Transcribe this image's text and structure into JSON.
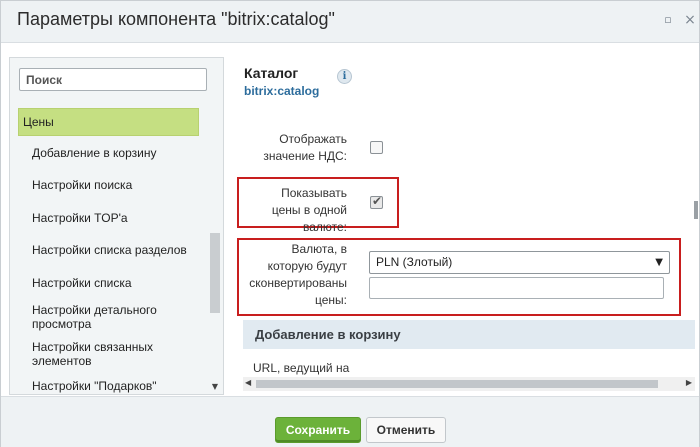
{
  "dialog": {
    "title": "Параметры компонента \"bitrix:catalog\"",
    "minimize_glyph": "▫",
    "close_glyph": "×"
  },
  "sidebar": {
    "search_placeholder": "Поиск",
    "items": [
      {
        "label": "Цены",
        "active": true
      },
      {
        "label": "Добавление в корзину"
      },
      {
        "label": "Настройки поиска"
      },
      {
        "label": "Настройки TOP'а"
      },
      {
        "label": "Настройки списка разделов"
      },
      {
        "label": "Настройки списка"
      },
      {
        "label": "Настройки детального просмотра"
      },
      {
        "label": "Настройки связанных элементов"
      },
      {
        "label": "Настройки \"Подарков\""
      }
    ],
    "scroll_down_glyph": "▼"
  },
  "component": {
    "title": "Каталог",
    "code": "bitrix:catalog",
    "info_glyph": "i"
  },
  "fields": {
    "show_vat": {
      "label": "Отображать значение НДС:",
      "checked": false
    },
    "one_currency": {
      "label": "Показывать цены в одной валюте:",
      "checked": true,
      "checkmark": "✔"
    },
    "currency": {
      "label": "Валюта, в которую будут сконвертированы цены:",
      "selected": "PLN (Злотый)",
      "caret": "▼",
      "extra_value": ""
    }
  },
  "section": {
    "title": "Добавление в корзину",
    "next_label": "URL, ведущий на"
  },
  "scroll": {
    "left_glyph": "◀",
    "right_glyph": "▶"
  },
  "footer": {
    "save_label": "Сохранить",
    "cancel_label": "Отменить"
  },
  "colors": {
    "accent_green": "#6cb23a",
    "active_item": "#c5df82",
    "highlight_red": "#c81e1e",
    "link_blue": "#2c6c9c"
  }
}
